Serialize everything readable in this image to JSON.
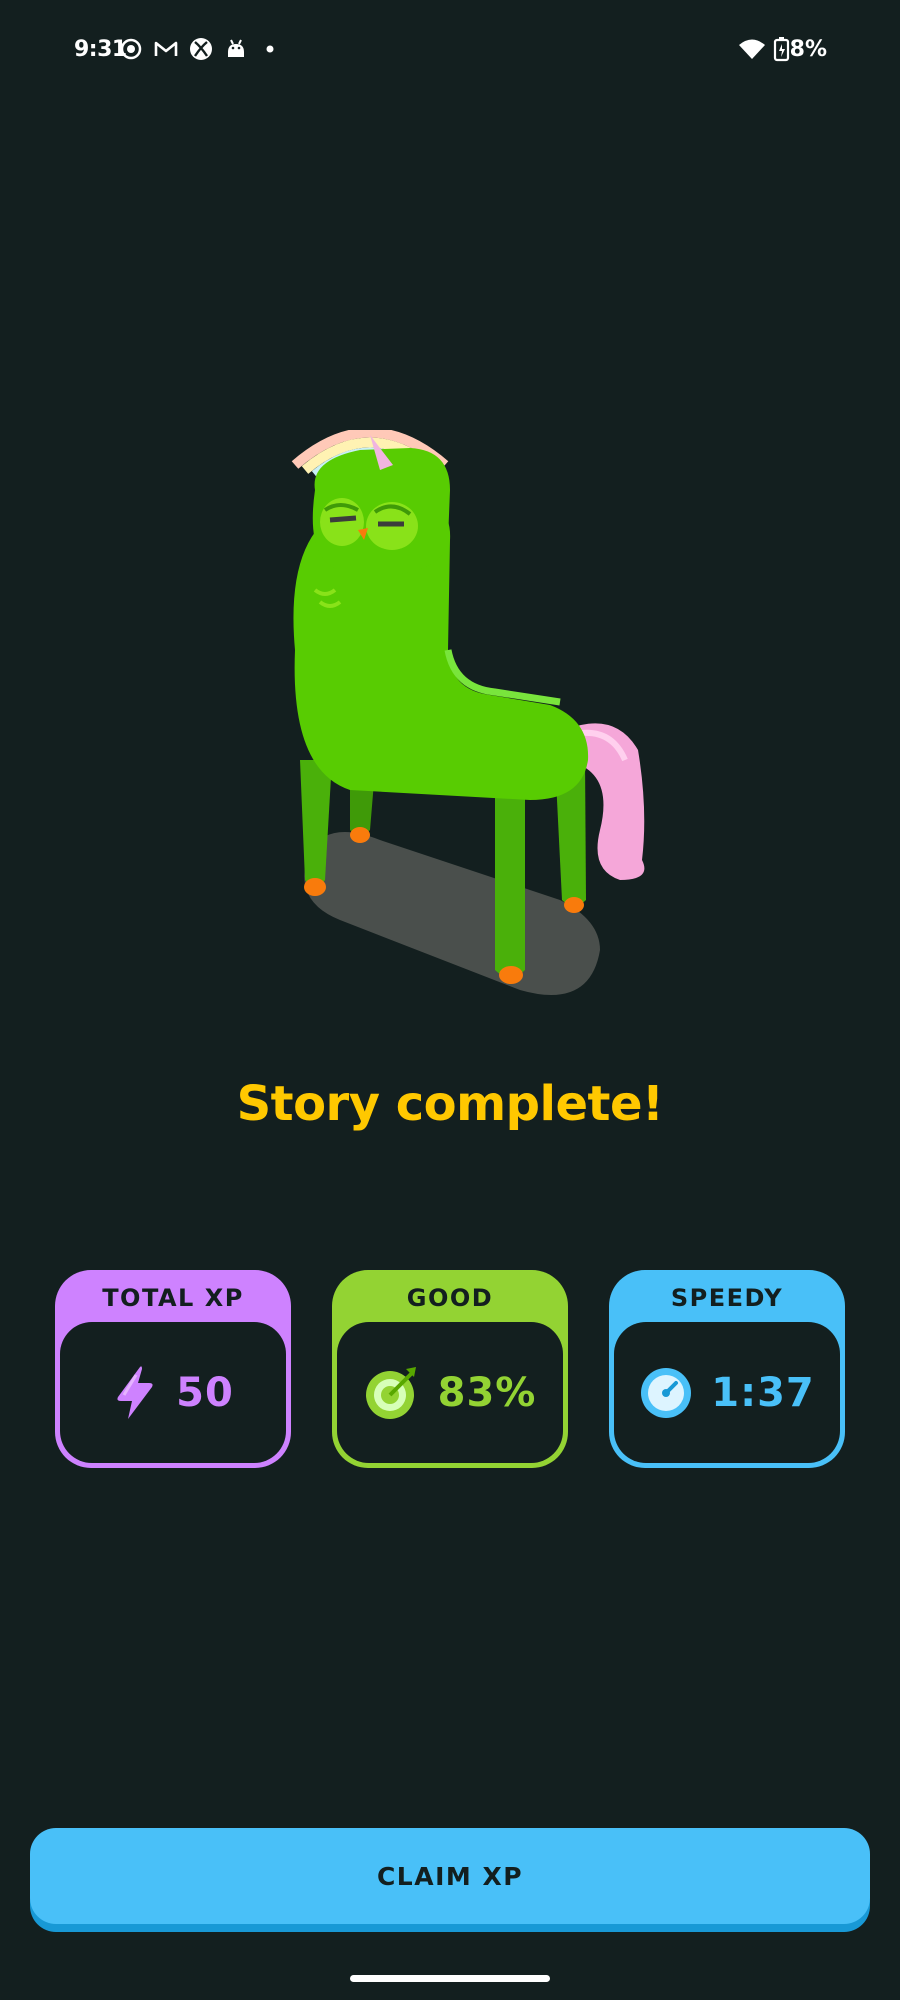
{
  "status_bar": {
    "time": "9:31",
    "battery": "8%",
    "icons": [
      "screen-record-icon",
      "gmail-icon",
      "xbox-icon",
      "android-icon",
      "dot-icon",
      "wifi-icon",
      "battery-icon"
    ]
  },
  "title": "Story complete!",
  "stats": [
    {
      "label": "TOTAL XP",
      "value": "50",
      "icon": "lightning-icon",
      "color": "#ce82ff"
    },
    {
      "label": "GOOD",
      "value": "83%",
      "icon": "target-icon",
      "color": "#93d333"
    },
    {
      "label": "SPEEDY",
      "value": "1:37",
      "icon": "stopwatch-icon",
      "color": "#49c0f8"
    }
  ],
  "claim_button": {
    "label": "CLAIM XP"
  },
  "colors": {
    "background": "#131f1f",
    "title": "#ffc800",
    "button": "#49c0f8"
  }
}
